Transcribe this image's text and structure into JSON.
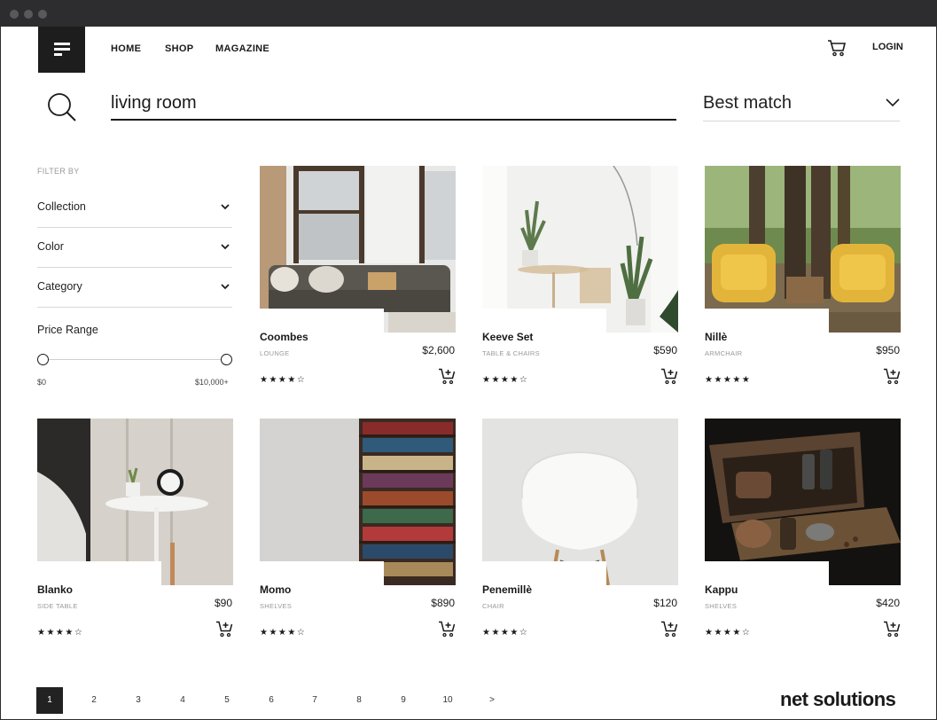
{
  "header": {
    "nav": [
      "HOME",
      "SHOP",
      "MAGAZINE"
    ],
    "login": "LOGIN"
  },
  "search": {
    "value": "living room",
    "sort": "Best match"
  },
  "filters": {
    "heading": "FILTER BY",
    "items": [
      "Collection",
      "Color",
      "Category"
    ],
    "price_label": "Price Range",
    "price_min": "$0",
    "price_max": "$10,000+"
  },
  "products": [
    {
      "name": "Coombes",
      "category": "LOUNGE",
      "price": "$2,600",
      "rating": 4,
      "stars": "★★★★☆"
    },
    {
      "name": "Keeve Set",
      "category": "TABLE & CHAIRS",
      "price": "$590",
      "rating": 4,
      "stars": "★★★★☆"
    },
    {
      "name": "Nillè",
      "category": "ARMCHAIR",
      "price": "$950",
      "rating": 5,
      "stars": "★★★★★"
    },
    {
      "name": "Blanko",
      "category": "SIDE TABLE",
      "price": "$90",
      "rating": 4,
      "stars": "★★★★☆"
    },
    {
      "name": "Momo",
      "category": "SHELVES",
      "price": "$890",
      "rating": 4,
      "stars": "★★★★☆"
    },
    {
      "name": "Penemillè",
      "category": "CHAIR",
      "price": "$120",
      "rating": 4,
      "stars": "★★★★☆"
    },
    {
      "name": "Kappu",
      "category": "SHELVES",
      "price": "$420",
      "rating": 4,
      "stars": "★★★★☆"
    }
  ],
  "pagination": {
    "pages": [
      "1",
      "2",
      "3",
      "4",
      "5",
      "6",
      "7",
      "8",
      "9",
      "10"
    ],
    "current": "1",
    "next": ">"
  },
  "brand": {
    "text": "net solutions",
    "accent_color": "#e74c3c"
  },
  "colors": {
    "dark": "#1d1d1d",
    "muted": "#999999",
    "divider": "#d8d8d8"
  },
  "icons": [
    "menu-logo-icon",
    "cart-icon",
    "search-icon",
    "chevron-down-icon",
    "add-to-cart-icon"
  ]
}
